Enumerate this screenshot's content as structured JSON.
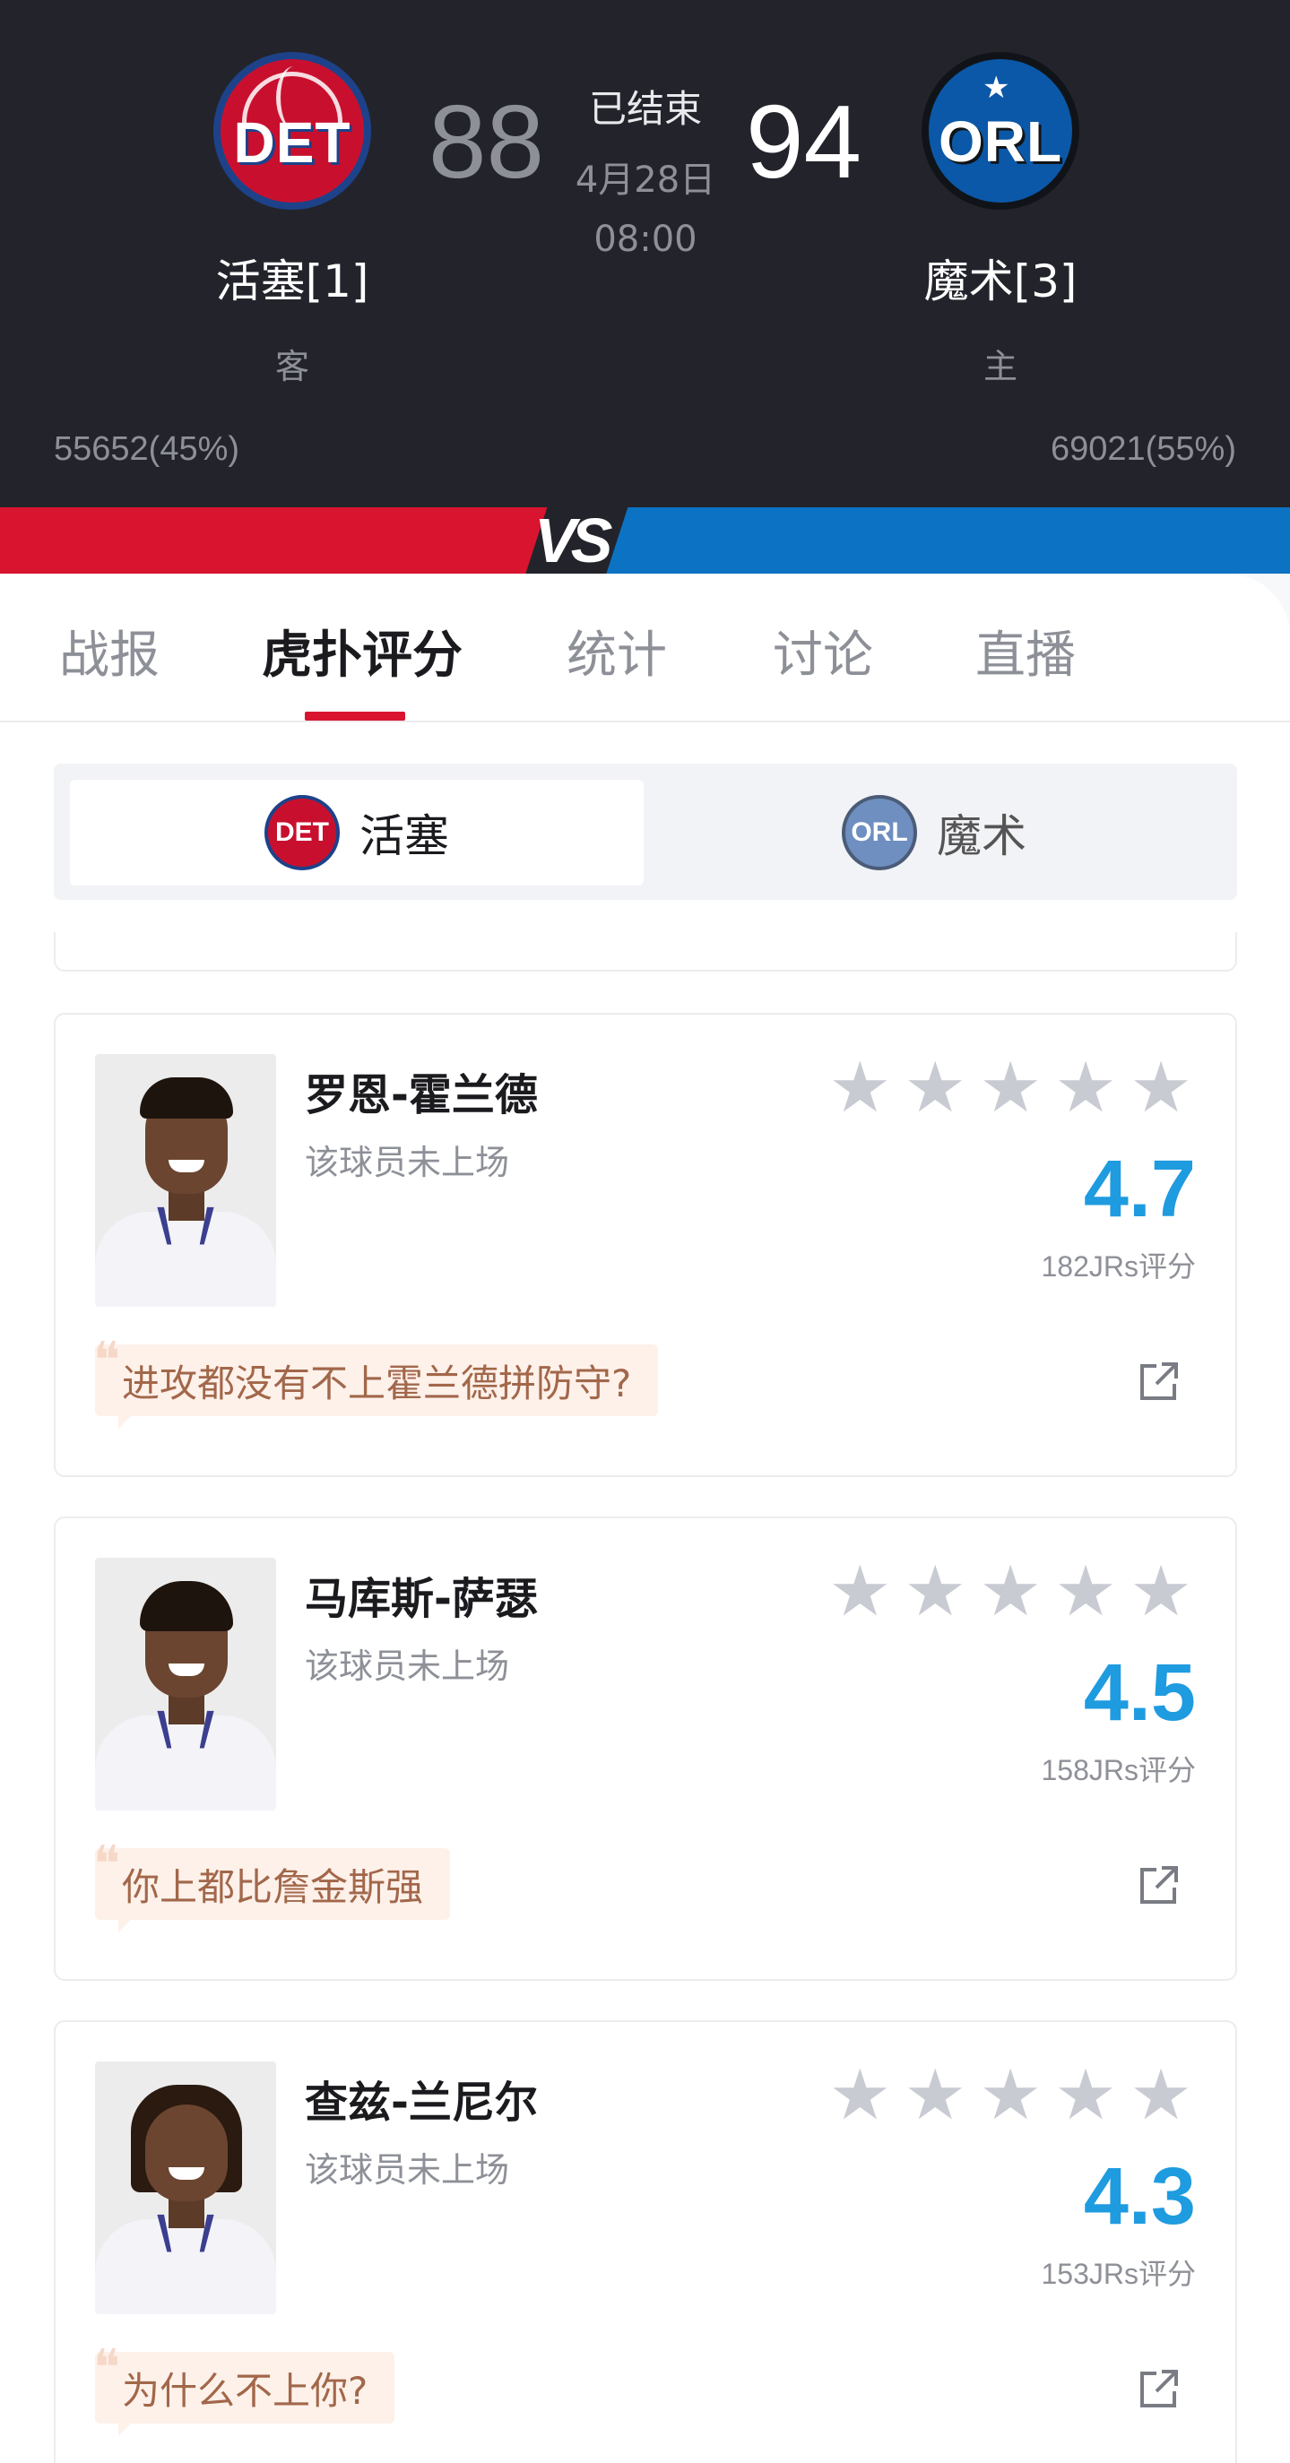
{
  "game": {
    "status": "已结束",
    "date": "4月28日",
    "time": "08:00"
  },
  "away_team": {
    "logo_text": "DET",
    "name": "活塞[1]",
    "role": "客",
    "score": "88",
    "support": "55652(45%)",
    "color": "#c8102e"
  },
  "home_team": {
    "logo_text": "ORL",
    "name": "魔术[3]",
    "role": "主",
    "score": "94",
    "support": "69021(55%)",
    "color": "#0b72c4"
  },
  "vs_label": "VS",
  "tabs": [
    {
      "label": "战报",
      "active": false
    },
    {
      "label": "虎扑评分",
      "active": true
    },
    {
      "label": "统计",
      "active": false
    },
    {
      "label": "讨论",
      "active": false
    },
    {
      "label": "直播",
      "active": false
    }
  ],
  "team_switch": {
    "options": [
      {
        "logo_text": "DET",
        "label": "活塞",
        "active": true
      },
      {
        "logo_text": "ORL",
        "label": "魔术",
        "active": false
      }
    ]
  },
  "players": [
    {
      "name": "罗恩-霍兰德",
      "status": "该球员未上场",
      "rating": "4.7",
      "rating_count": "182JRs评分",
      "comment": "进攻都没有不上霍兰德拼防守?",
      "stars": 5
    },
    {
      "name": "马库斯-萨瑟",
      "status": "该球员未上场",
      "rating": "4.5",
      "rating_count": "158JRs评分",
      "comment": "你上都比詹金斯强",
      "stars": 5
    },
    {
      "name": "查兹-兰尼尔",
      "status": "该球员未上场",
      "rating": "4.3",
      "rating_count": "153JRs评分",
      "comment": "为什么不上你?",
      "stars": 5
    }
  ],
  "colors": {
    "accent_red": "#d9142f",
    "accent_blue": "#0b72c4",
    "rating_blue": "#1f9be0",
    "header_bg": "#23242b"
  }
}
